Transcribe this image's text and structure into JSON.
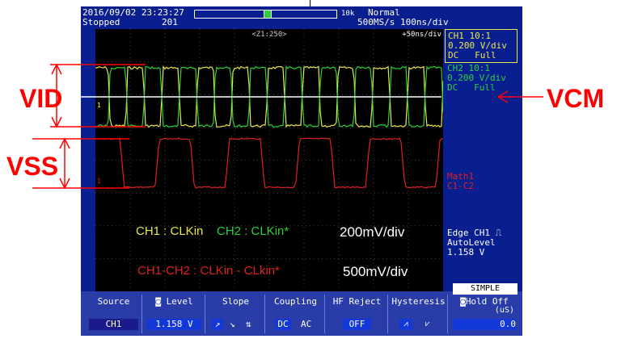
{
  "header": {
    "datetime": "2016/09/02 23:23:27",
    "status": "Stopped",
    "count": "201",
    "record_length": "10k",
    "trigger_mode": "Normal",
    "sample_rate": "500MS/s 100ns/div",
    "zoom_label": "<Z1:250>",
    "zoom_timebase": "+50ns/div"
  },
  "channels": {
    "ch1": {
      "line1": "CH1 10:1",
      "line2": "0.200 V/div",
      "line3": "DC   Full"
    },
    "ch2": {
      "line1": "CH2 10:1",
      "line2": "0.200 V/div",
      "line3": "DC   Full"
    },
    "math": {
      "line1": "Math1",
      "line2": "C1-C2"
    }
  },
  "trigger": {
    "line1": "Edge CH1",
    "line2": "AutoLevel",
    "line3": "1.158 V"
  },
  "annotations": {
    "vid": "VID",
    "vss": "VSS",
    "vcm": "VCM",
    "cap1_a": "CH1 : CLKin ",
    "cap1_b": "CH2 : CLKin*",
    "cap1_scale": "200mV/div",
    "cap2": "CH1-CH2 : CLKin - CLkin*",
    "cap2_scale": "500mV/div"
  },
  "softkeys": {
    "mode_label": "SIMPLE",
    "source": {
      "title": "Source",
      "value": "CH1"
    },
    "level": {
      "title": "Level",
      "value": "1.158 V"
    },
    "slope": {
      "title": "Slope"
    },
    "coupling": {
      "title": "Coupling",
      "opt1": "DC",
      "opt2": "AC"
    },
    "hf_reject": {
      "title": "HF Reject",
      "value": "OFF"
    },
    "hysteresis": {
      "title": "Hysteresis"
    },
    "hold_off": {
      "title": "Hold Off",
      "unit": "(uS)",
      "value": "0.0"
    }
  },
  "colors": {
    "ch1": "#e8e84a",
    "ch2": "#2fcf3c",
    "math": "#e02020",
    "annotation": "#ff0000"
  }
}
